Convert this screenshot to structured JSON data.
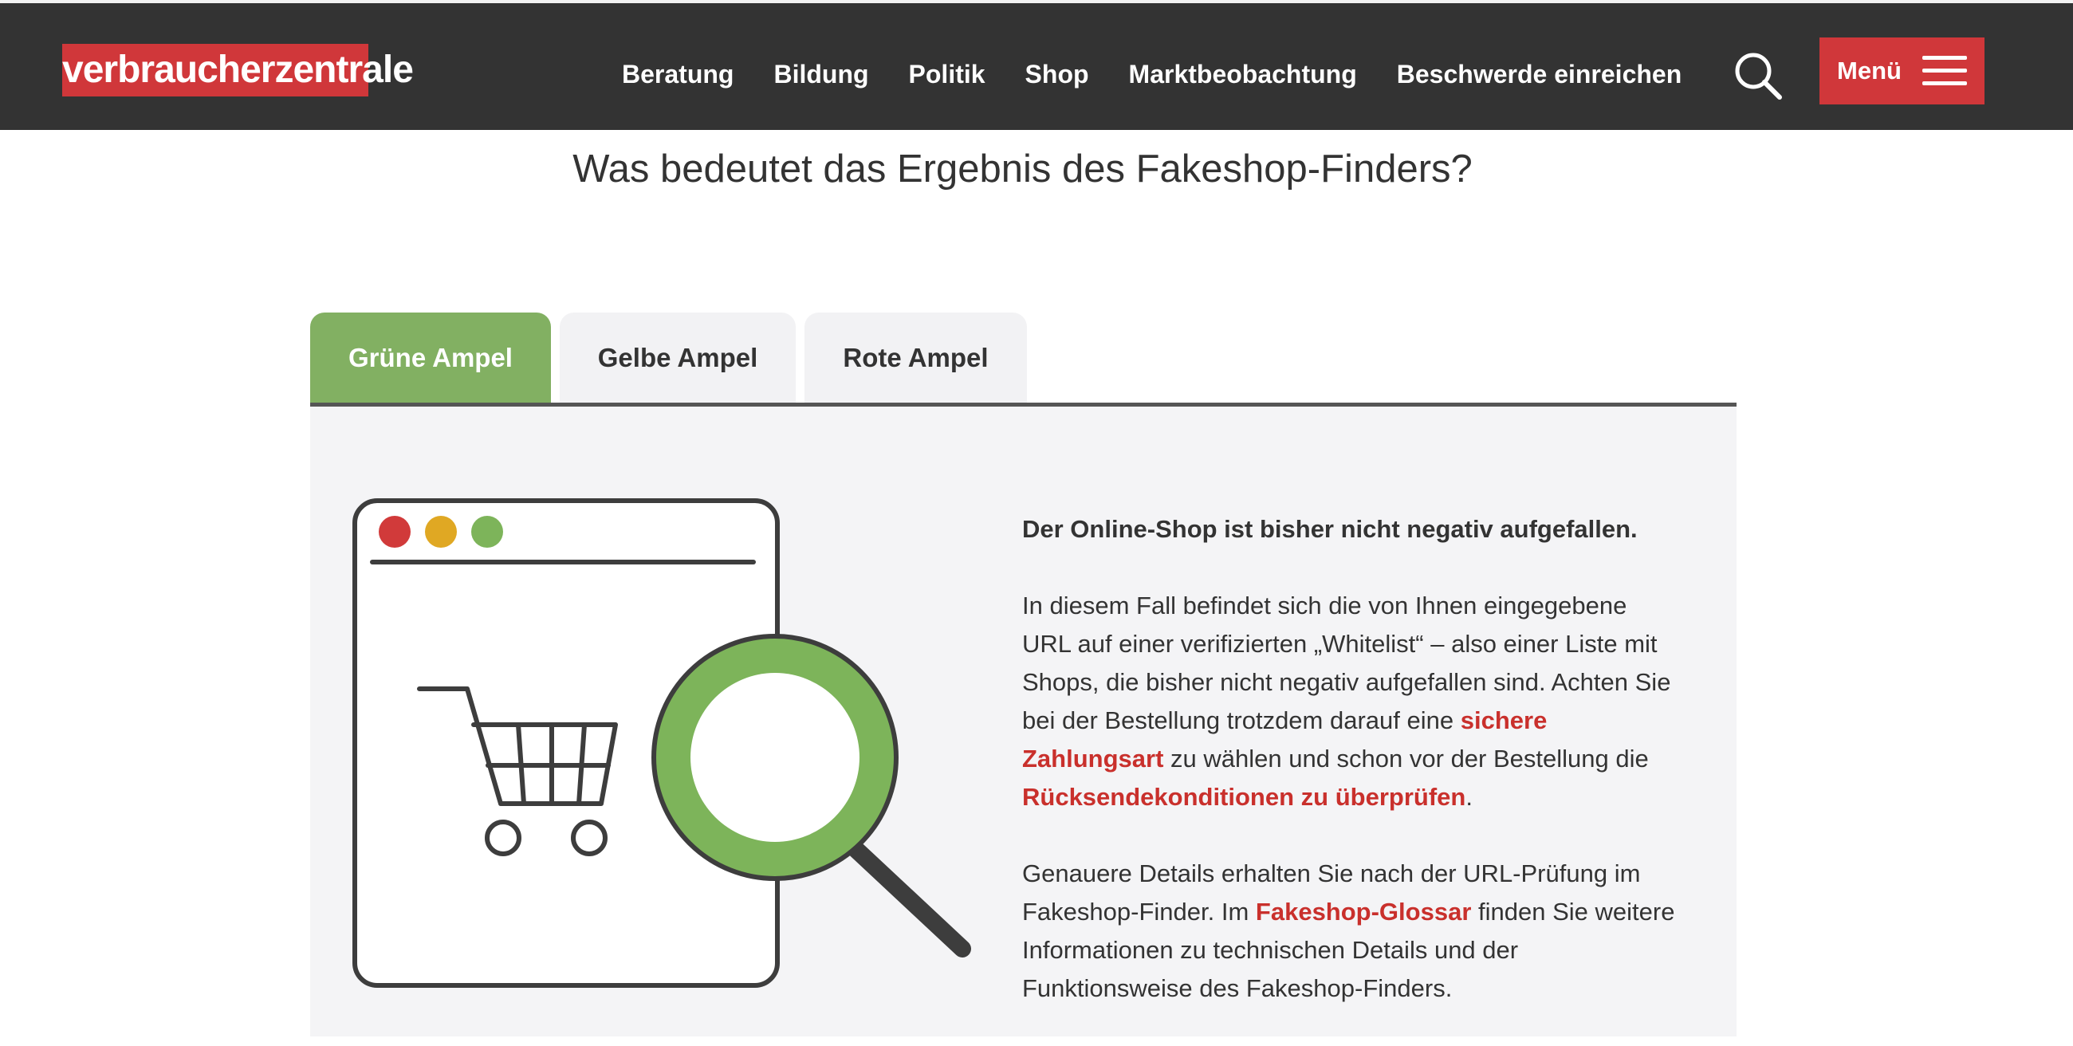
{
  "header": {
    "logo_text": "verbraucherzentrale",
    "nav": [
      {
        "label": "Beratung"
      },
      {
        "label": "Bildung"
      },
      {
        "label": "Politik"
      },
      {
        "label": "Shop"
      },
      {
        "label": "Marktbeobachtung"
      },
      {
        "label": "Beschwerde einreichen"
      }
    ],
    "search_icon": "search-icon",
    "menu_label": "Menü",
    "menu_icon": "hamburger-icon"
  },
  "page": {
    "title": "Was bedeutet das Ergebnis des Fakeshop-Finders?"
  },
  "tabs": [
    {
      "label": "Grüne Ampel",
      "active": true
    },
    {
      "label": "Gelbe Ampel",
      "active": false
    },
    {
      "label": "Rote Ampel",
      "active": false
    }
  ],
  "panel": {
    "lead": "Der Online-Shop ist bisher nicht negativ aufgefallen.",
    "p1": {
      "text1": "In diesem Fall befindet sich die von Ihnen eingegebene URL auf einer verifizierten „Whitelist“ – also einer Liste mit Shops, die bisher nicht negativ aufgefallen sind. Achten Sie bei der Bestellung trotzdem darauf eine ",
      "link1": "sichere Zahlungsart",
      "text2": " zu wählen und schon vor der Bestellung die ",
      "link2": "Rücksendekonditionen zu überprüfen",
      "text3": "."
    },
    "p2": {
      "text1": "Genauere Details erhalten Sie nach der URL-Prüfung im Fakeshop-Finder. Im ",
      "link1": "Fakeshop-Glossar",
      "text2": " finden Sie weitere Informationen zu technischen Details und der Funktionsweise des Fakeshop-Finders."
    }
  },
  "colors": {
    "brand_red": "#d0373a",
    "header_bg": "#333333",
    "tab_active": "#82b062",
    "dot_red": "#d13a3a",
    "dot_yellow": "#e0a823",
    "dot_green": "#7db45a",
    "link": "#c9302c"
  }
}
